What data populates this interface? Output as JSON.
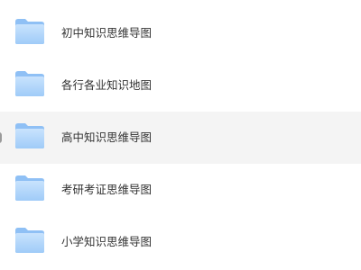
{
  "folders": [
    {
      "label": "初中知识思维导图",
      "icon": "folder-icon",
      "selected": false
    },
    {
      "label": "各行各业知识地图",
      "icon": "folder-icon",
      "selected": false
    },
    {
      "label": "高中知识思维导图",
      "icon": "folder-icon",
      "selected": true
    },
    {
      "label": "考研考证思维导图",
      "icon": "folder-icon",
      "selected": false
    },
    {
      "label": "小学知识思维导图",
      "icon": "folder-icon",
      "selected": false
    }
  ],
  "colors": {
    "folder_back": "#8fc0f5",
    "folder_front_top": "#c9e3fd",
    "folder_front_bottom": "#9fcbf8",
    "selected_row_bg": "#f4f4f4",
    "label_text": "#333333"
  }
}
